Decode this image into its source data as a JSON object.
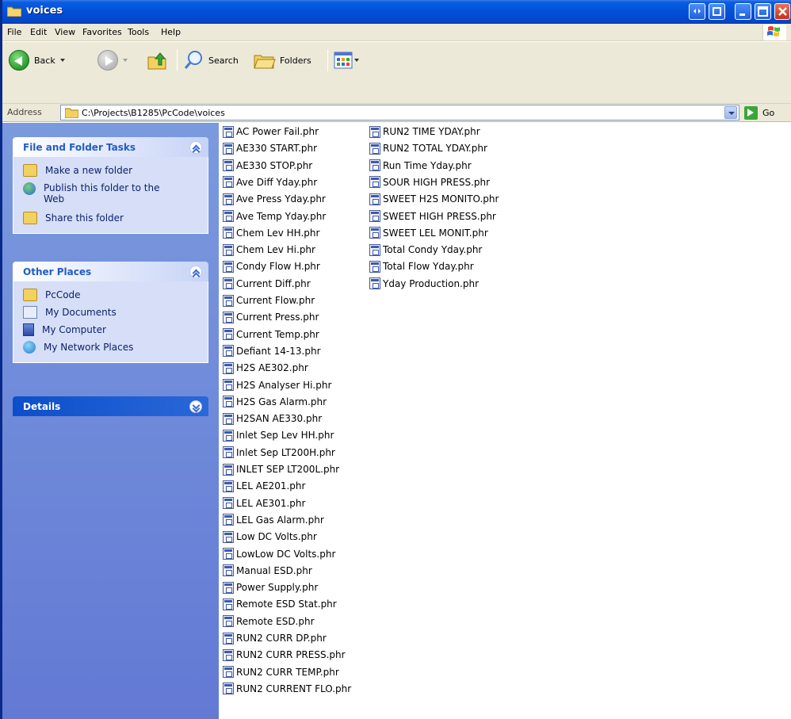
{
  "window": {
    "title": "voices"
  },
  "menu": [
    {
      "label": "File",
      "u": "F",
      "rest": "ile"
    },
    {
      "label": "Edit",
      "u": "E",
      "rest": "dit"
    },
    {
      "label": "View",
      "u": "V",
      "rest": "iew"
    },
    {
      "label": "Favorites",
      "u": "a",
      "pre": "F",
      "rest": "vorites"
    },
    {
      "label": "Tools",
      "u": "T",
      "rest": "ools"
    },
    {
      "label": "Help",
      "u": "H",
      "rest": "elp"
    }
  ],
  "toolbar": {
    "back_label": "Back",
    "search_label": "Search",
    "folders_label": "Folders"
  },
  "address": {
    "label": "Address",
    "path": "C:\\Projects\\B1285\\PcCode\\voices",
    "go_label": "Go"
  },
  "left": {
    "file_tasks": {
      "title": "File and Folder Tasks",
      "items": [
        "Make a new folder",
        "Publish this folder to the Web",
        "Share this folder"
      ]
    },
    "other_places": {
      "title": "Other Places",
      "items": [
        "PcCode",
        "My Documents",
        "My Computer",
        "My Network Places"
      ]
    },
    "details": {
      "title": "Details"
    }
  },
  "files": {
    "column1": [
      "AC Power Fail.phr",
      "AE330 START.phr",
      "AE330 STOP.phr",
      "Ave Diff Yday.phr",
      "Ave Press Yday.phr",
      "Ave Temp Yday.phr",
      "Chem Lev HH.phr",
      "Chem Lev Hi.phr",
      "Condy Flow H.phr",
      "Current Diff.phr",
      "Current Flow.phr",
      "Current Press.phr",
      "Current Temp.phr",
      "Defiant 14-13.phr",
      "H2S AE302.phr",
      "H2S Analyser Hi.phr",
      "H2S Gas Alarm.phr",
      "H2SAN AE330.phr",
      "Inlet Sep Lev HH.phr",
      "Inlet Sep LT200H.phr",
      "INLET SEP LT200L.phr",
      "LEL AE201.phr",
      "LEL AE301.phr",
      "LEL Gas Alarm.phr",
      "Low DC Volts.phr",
      "LowLow DC Volts.phr",
      "Manual ESD.phr",
      "Power Supply.phr",
      "Remote ESD Stat.phr",
      "Remote ESD.phr",
      "RUN2 CURR DP.phr",
      "RUN2 CURR PRESS.phr",
      "RUN2 CURR TEMP.phr",
      "RUN2 CURRENT FLO.phr"
    ],
    "column2": [
      "RUN2 TIME YDAY.phr",
      "RUN2 TOTAL YDAY.phr",
      "Run Time Yday.phr",
      "SOUR HIGH PRESS.phr",
      "SWEET H2S MONITO.phr",
      "SWEET HIGH PRESS.phr",
      "SWEET LEL MONIT.phr",
      "Total Condy Yday.phr",
      "Total Flow Yday.phr",
      "Yday Production.phr"
    ]
  }
}
